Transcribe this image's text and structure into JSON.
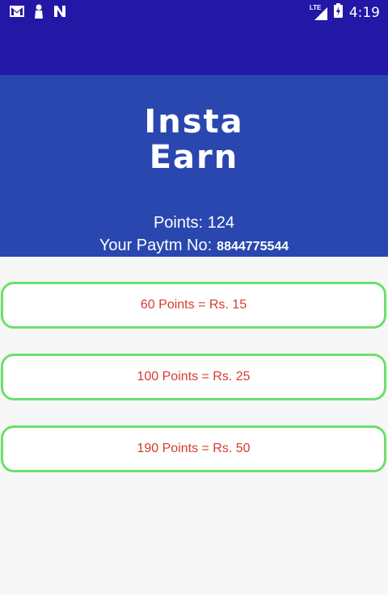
{
  "status_bar": {
    "left_icons": [
      "gmail-icon",
      "person-silhouette-icon",
      "n-notification-icon"
    ],
    "network_label": "LTE",
    "time": "4:19"
  },
  "header": {
    "title_line1": "Insta",
    "title_line2": "Earn",
    "points_text": "Points: 124",
    "paytm_label": "Your Paytm No:",
    "paytm_number": "8844775544"
  },
  "rewards": [
    {
      "label": "60 Points = Rs. 15"
    },
    {
      "label": "100 Points = Rs. 25"
    },
    {
      "label": "190 Points = Rs. 50"
    }
  ],
  "colors": {
    "status_bar": "#2317a6",
    "header": "#2a47b0",
    "card_border": "#6be06b",
    "card_text": "#d63a2f"
  }
}
